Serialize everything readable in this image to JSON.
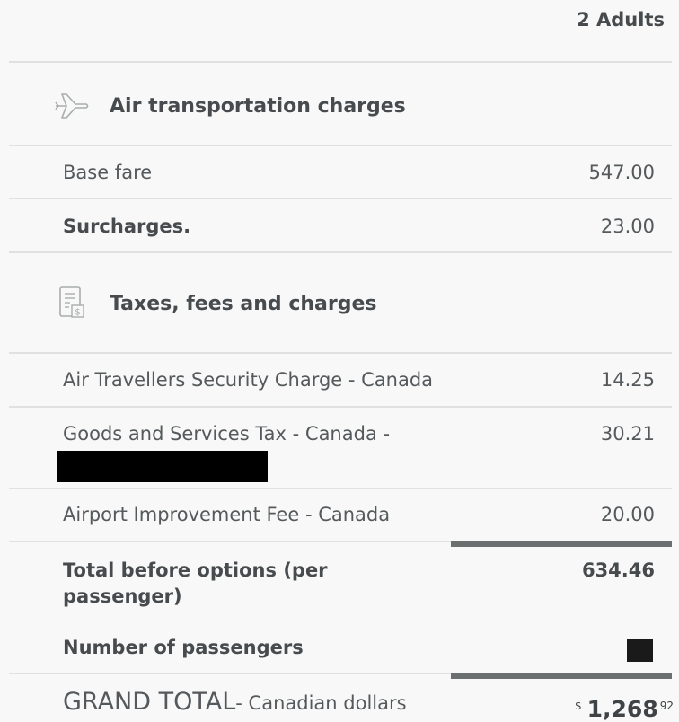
{
  "header": {
    "passengers_label": "2 Adults"
  },
  "sections": {
    "air": {
      "icon": "airplane-icon",
      "title": "Air transportation charges"
    },
    "taxes": {
      "icon": "receipt-icon",
      "title": "Taxes, fees and charges"
    }
  },
  "rows": {
    "base_fare": {
      "name": "Base fare",
      "amount": "547.00"
    },
    "surcharges": {
      "name": "Surcharges.",
      "amount": "23.00"
    },
    "atsc": {
      "name": "Air Travellers Security Charge - Canada",
      "amount": "14.25"
    },
    "gst": {
      "name": "Goods and Services Tax - Canada -",
      "amount": "30.21"
    },
    "aif": {
      "name": "Airport Improvement Fee - Canada",
      "amount": "20.00"
    },
    "total_before_line1": "Total before options  (per",
    "total_before_line2": "passenger)",
    "total_before_amount": "634.46",
    "num_passengers": {
      "name": "Number of passengers"
    }
  },
  "grand_total": {
    "label": "GRAND TOTAL",
    "sublabel": "- Canadian dollars",
    "currency_symbol": "$",
    "whole": "1,268",
    "cents": "92"
  },
  "colors": {
    "background": "#f7f8f7",
    "text": "#4a4f52",
    "divider": "#dfe2e1",
    "thick_divider": "#6b6f70"
  }
}
